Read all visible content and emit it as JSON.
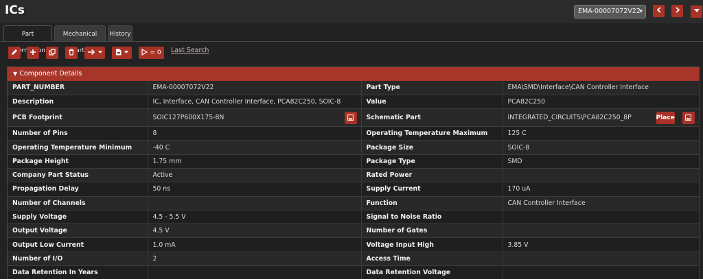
{
  "header": {
    "title": "ICs",
    "part_selector_value": "EMA-00007072V22"
  },
  "nav": {
    "prev_icon": "chevron-left-icon",
    "next_icon": "chevron-right-icon",
    "menu_icon": "caret-down-icon"
  },
  "tabs": [
    {
      "label": "Part Information",
      "active": true
    },
    {
      "label": "Mechanical Parts",
      "active": false
    },
    {
      "label": "History",
      "active": false
    }
  ],
  "toolbar": {
    "edit_icon": "pencil-icon",
    "add_icon": "plus-icon",
    "copy_icon": "copy-icon",
    "delete_icon": "trash-icon",
    "move_icon": "arrow-right-icon",
    "document_icon": "document-icon",
    "compare_icon": "compare-icon",
    "compare_label": "= 0",
    "last_search_label": "Last Search"
  },
  "panel": {
    "title": "Component Details",
    "toggle_icon": "triangle-down-icon",
    "place_label": "Place",
    "footprint_icon": "image-icon",
    "schematic_icon": "image-icon"
  },
  "rows": [
    {
      "l1": "PART_NUMBER",
      "v1": "EMA-00007072V22",
      "l2": "Part Type",
      "v2": "EMA\\SMD\\Interface\\CAN Controller Interface"
    },
    {
      "l1": "Description",
      "v1": "IC, Interface, CAN Controller Interface, PCA82C250, SOIC-8",
      "l2": "Value",
      "v2": "PCA82C250"
    },
    {
      "l1": "PCB Footprint",
      "v1": "SOIC127P600X175-8N",
      "l2": "Schematic Part",
      "v2": "INTEGRATED_CIRCUITS\\PCA82C250_8P"
    },
    {
      "l1": "Number of Pins",
      "v1": "8",
      "l2": "Operating Temperature Maximum",
      "v2": "125 C"
    },
    {
      "l1": "Operating Temperature Minimum",
      "v1": "-40 C",
      "l2": "Package Size",
      "v2": "SOIC-8"
    },
    {
      "l1": "Package Height",
      "v1": "1.75 mm",
      "l2": "Package Type",
      "v2": "SMD"
    },
    {
      "l1": "Company Part Status",
      "v1": "Active",
      "l2": "Rated Power",
      "v2": ""
    },
    {
      "l1": "Propagation Delay",
      "v1": "50 ns",
      "l2": "Supply Current",
      "v2": "170 uA"
    },
    {
      "l1": "Number of Channels",
      "v1": "",
      "l2": "Function",
      "v2": "CAN Controller Interface"
    },
    {
      "l1": "Supply Voltage",
      "v1": "4.5 - 5.5 V",
      "l2": "Signal to Noise Ratio",
      "v2": ""
    },
    {
      "l1": "Output Voltage",
      "v1": "4.5 V",
      "l2": "Number of Gates",
      "v2": ""
    },
    {
      "l1": "Output Low Current",
      "v1": "1.0 mA",
      "l2": "Voltage Input High",
      "v2": "3.85 V"
    },
    {
      "l1": "Number of I/O",
      "v1": "2",
      "l2": "Access Time",
      "v2": ""
    },
    {
      "l1": "Data Retention In Years",
      "v1": "",
      "l2": "Data Retention Voltage",
      "v2": ""
    }
  ],
  "colors": {
    "accent": "#a93226",
    "background": "#222222",
    "panel_header": "#a8352a"
  }
}
